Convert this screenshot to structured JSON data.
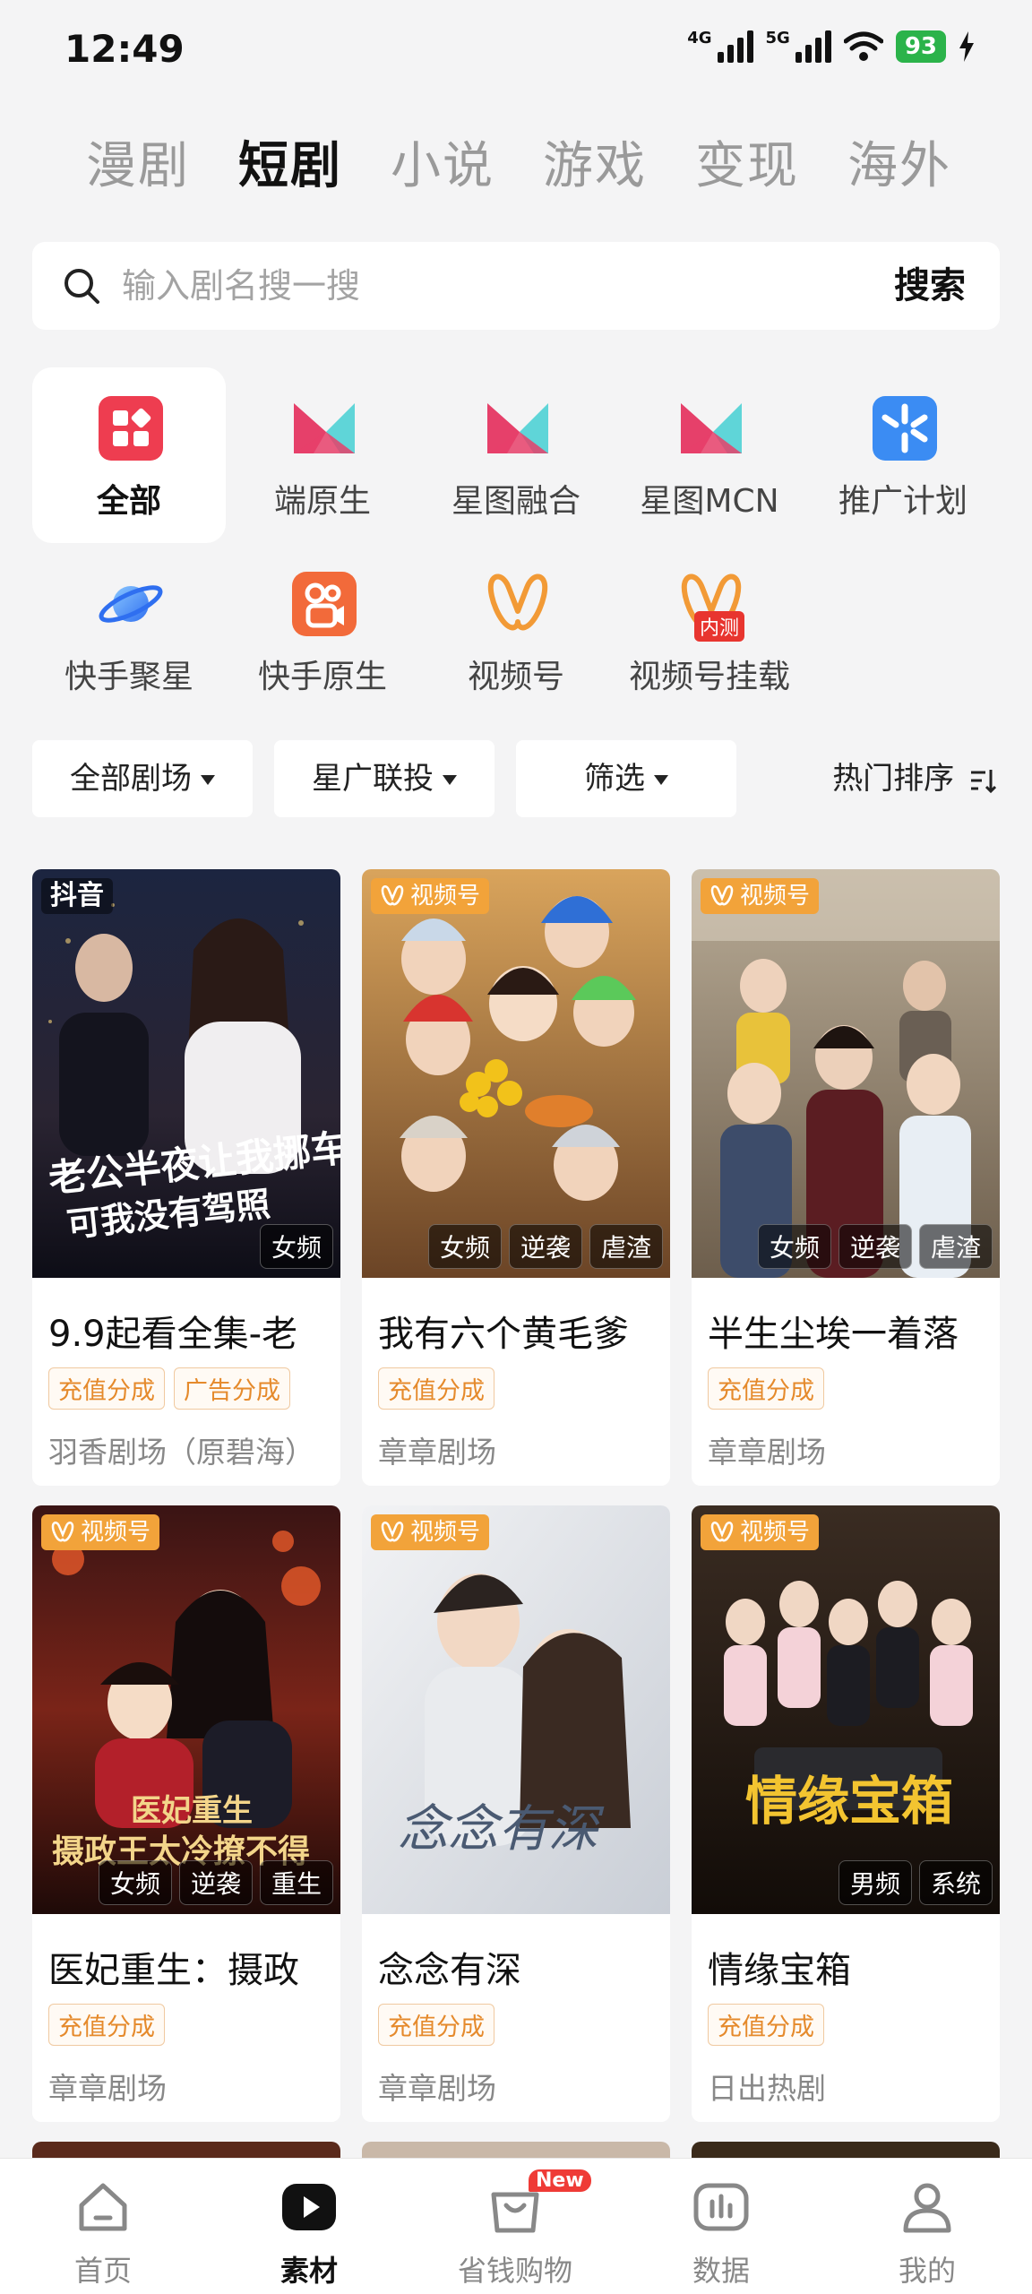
{
  "status_bar": {
    "time": "12:49",
    "net1": "4G",
    "net2": "5G",
    "battery": "93"
  },
  "top_tabs": [
    {
      "label": "漫剧",
      "active": false
    },
    {
      "label": "短剧",
      "active": true
    },
    {
      "label": "小说",
      "active": false
    },
    {
      "label": "游戏",
      "active": false
    },
    {
      "label": "变现",
      "active": false
    },
    {
      "label": "海外",
      "active": false
    }
  ],
  "search": {
    "placeholder": "输入剧名搜一搜",
    "button": "搜索"
  },
  "categories": [
    {
      "label": "全部",
      "icon": "grid-icon"
    },
    {
      "label": "端原生",
      "icon": "xingtu-icon"
    },
    {
      "label": "星图融合",
      "icon": "xingtu-icon"
    },
    {
      "label": "星图MCN",
      "icon": "xingtu-icon"
    },
    {
      "label": "推广计划",
      "icon": "promotion-plan-icon"
    },
    {
      "label": "快手聚星",
      "icon": "planet-icon"
    },
    {
      "label": "快手原生",
      "icon": "kuaishou-icon"
    },
    {
      "label": "视频号",
      "icon": "channels-icon"
    },
    {
      "label": "视频号挂载",
      "icon": "channels-icon",
      "badge": "内测"
    }
  ],
  "filters": {
    "theater": "全部剧场",
    "joint": "星广联投",
    "filter": "筛选",
    "sort": "热门排序"
  },
  "cards": [
    {
      "platform": "抖音",
      "tags": [
        "女频"
      ],
      "title": "9.9起看全集-老",
      "pills": [
        "充值分成",
        "广告分成"
      ],
      "studio": "羽香剧场（原碧海）"
    },
    {
      "platform": "视频号",
      "tags": [
        "女频",
        "逆袭",
        "虐渣"
      ],
      "title": "我有六个黄毛爹",
      "pills": [
        "充值分成"
      ],
      "studio": "章章剧场"
    },
    {
      "platform": "视频号",
      "tags": [
        "女频",
        "逆袭",
        "虐渣"
      ],
      "title": "半生尘埃一着落",
      "pills": [
        "充值分成"
      ],
      "studio": "章章剧场"
    },
    {
      "platform": "视频号",
      "tags": [
        "女频",
        "逆袭",
        "重生"
      ],
      "title": "医妃重生：摄政",
      "pills": [
        "充值分成"
      ],
      "studio": "章章剧场"
    },
    {
      "platform": "视频号",
      "tags": [],
      "title": "念念有深",
      "pills": [
        "充值分成"
      ],
      "studio": "章章剧场"
    },
    {
      "platform": "视频号",
      "tags": [
        "男频",
        "系统"
      ],
      "title": "情缘宝箱",
      "pills": [
        "充值分成"
      ],
      "studio": "日出热剧"
    }
  ],
  "bottom_nav": [
    {
      "label": "首页",
      "icon": "home-icon",
      "active": false
    },
    {
      "label": "素材",
      "icon": "play-icon",
      "active": true
    },
    {
      "label": "省钱购物",
      "icon": "shopping-bag-icon",
      "active": false,
      "badge": "New"
    },
    {
      "label": "数据",
      "icon": "chart-icon",
      "active": false
    },
    {
      "label": "我的",
      "icon": "profile-icon",
      "active": false
    }
  ]
}
